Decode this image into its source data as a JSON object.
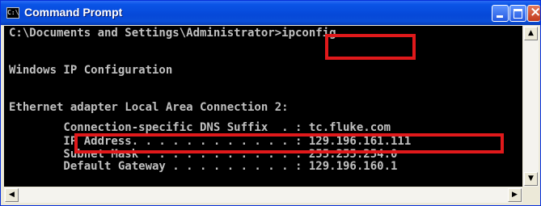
{
  "window": {
    "title": "Command Prompt",
    "app_icon_label": "C:\\"
  },
  "console": {
    "lines": [
      "C:\\Documents and Settings\\Administrator>ipconfig",
      "",
      "Windows IP Configuration",
      "",
      "",
      "Ethernet adapter Local Area Connection 2:",
      "",
      "        Connection-specific DNS Suffix  . : tc.fluke.com",
      "        IP Address. . . . . . . . . . . . : 129.196.161.111",
      "        Subnet Mask . . . . . . . . . . . : 255.255.254.0",
      "        Default Gateway . . . . . . . . . : 129.196.160.1"
    ]
  },
  "highlight_color": "#e0191b",
  "icons": {
    "scroll_up": "▲",
    "scroll_down": "▼",
    "scroll_left": "◀",
    "scroll_right": "▶"
  }
}
